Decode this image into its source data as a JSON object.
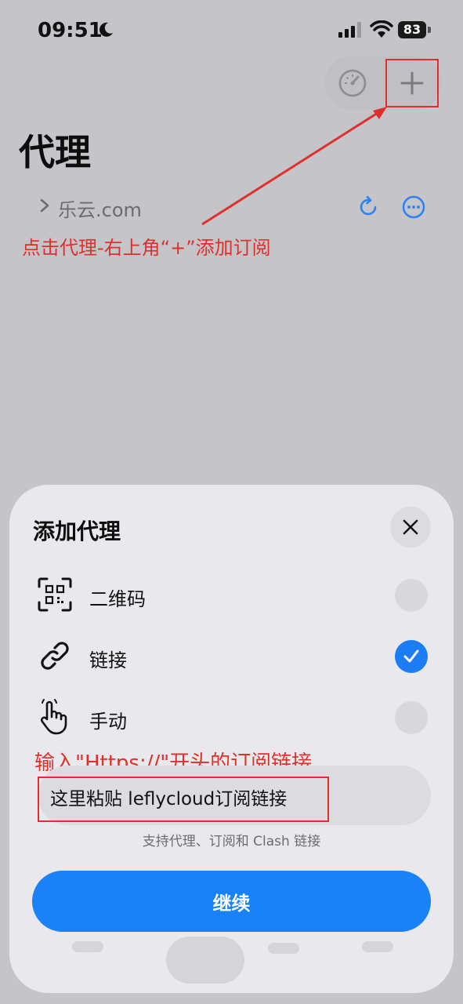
{
  "status_bar": {
    "time": "09:51",
    "battery_level": "83"
  },
  "header": {
    "title": "代理"
  },
  "subscription": {
    "name": "乐云.com"
  },
  "annotations": {
    "step1": "点击代理-右上角“+”添加订阅",
    "step2": "输入\"Https://\"开头的订阅链接"
  },
  "sheet": {
    "title": "添加代理",
    "options": [
      {
        "label": "二维码",
        "icon": "qr-code-icon",
        "selected": false
      },
      {
        "label": "链接",
        "icon": "link-icon",
        "selected": true
      },
      {
        "label": "手动",
        "icon": "hand-pointer-icon",
        "selected": false
      }
    ],
    "input": {
      "placeholder": "这里粘贴 leflycloud订阅链接"
    },
    "hint": "支持代理、订阅和 Clash 链接",
    "continue_label": "继续"
  },
  "colors": {
    "accent": "#1a82f7",
    "annotation": "#e0302c",
    "background": "#c4c4c9",
    "sheet": "#e9e9ed"
  }
}
